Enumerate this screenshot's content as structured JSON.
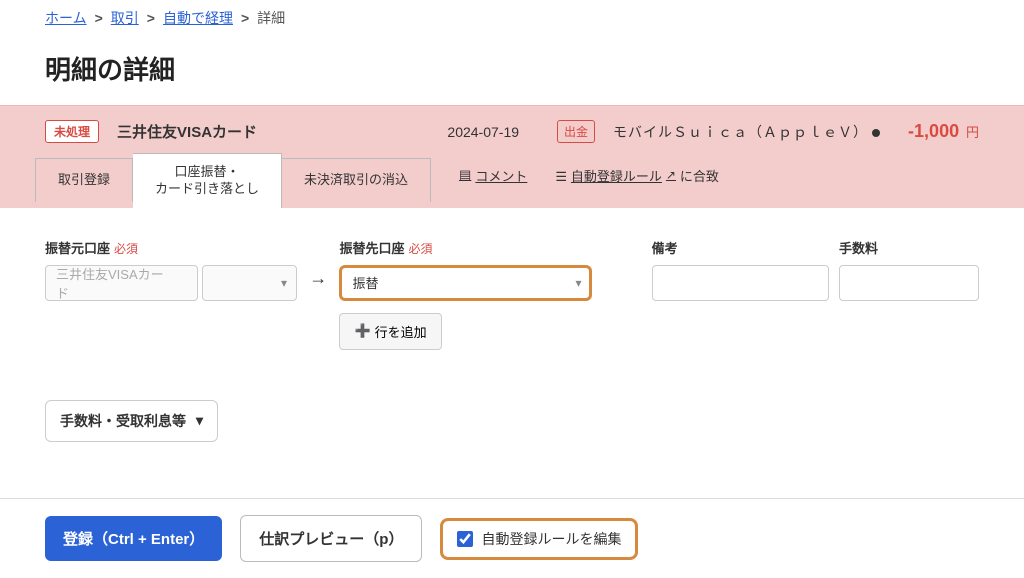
{
  "breadcrumb": {
    "home": "ホーム",
    "transactions": "取引",
    "auto_accounting": "自動で経理",
    "current": "詳細"
  },
  "page_title": "明細の詳細",
  "summary": {
    "status_badge": "未処理",
    "card_name": "三井住友VISAカード",
    "date": "2024-07-19",
    "withdraw_badge": "出金",
    "description": "モバイルＳｕｉｃａ（ＡｐｐｌｅＶ）",
    "amount": "-1,000",
    "amount_unit": "円"
  },
  "tabs": {
    "register": "取引登録",
    "account_transfer": "口座振替・\nカード引き落とし",
    "unsettled": "未決済取引の消込"
  },
  "side_links": {
    "comment": "コメント",
    "auto_rule": "自動登録ルール",
    "match_suffix": "に合致"
  },
  "form": {
    "src_label": "振替元口座",
    "dst_label": "振替先口座",
    "note_label": "備考",
    "fee_label": "手数料",
    "required": "必須",
    "src_value": "三井住友VISAカード",
    "dst_value": "振替",
    "add_row": "行を追加"
  },
  "fees_dropdown": "手数料・受取利息等",
  "footer": {
    "register_btn": "登録（Ctrl + Enter）",
    "preview_btn": "仕訳プレビュー（p）",
    "edit_rule_label": "自動登録ルールを編集"
  }
}
